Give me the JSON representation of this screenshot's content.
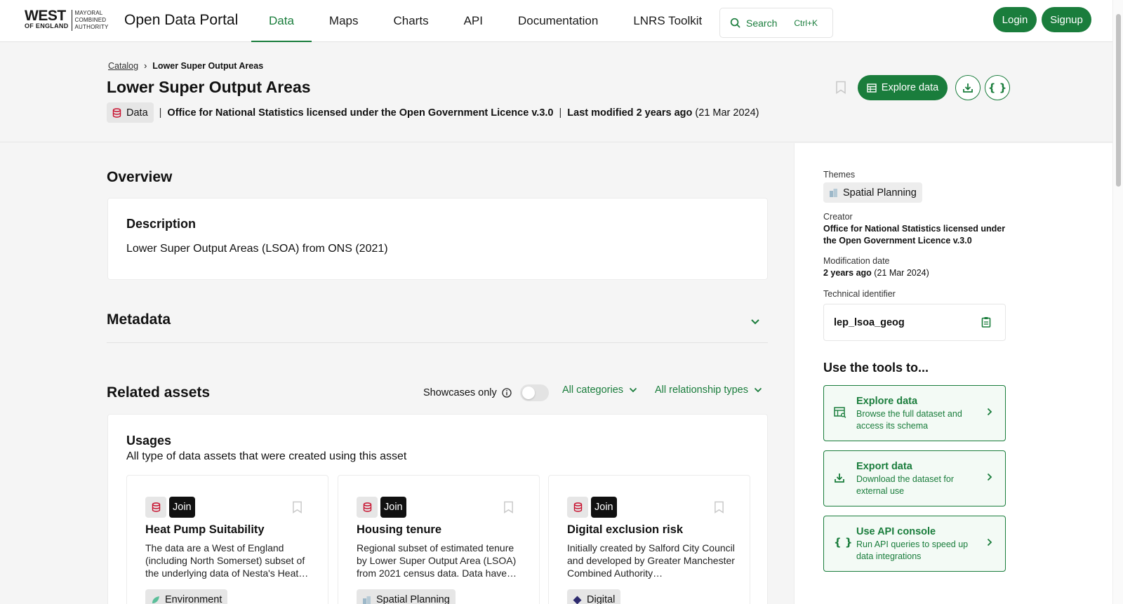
{
  "header": {
    "logo_main_1": "WEST",
    "logo_main_2": "OF ENGLAND",
    "logo_right_1": "MAYORAL",
    "logo_right_2": "COMBINED",
    "logo_right_3": "AUTHORITY",
    "portal_title": "Open Data Portal",
    "nav": [
      "Data",
      "Maps",
      "Charts",
      "API",
      "Documentation",
      "LNRS Toolkit"
    ],
    "active_nav": "Data",
    "search_label": "Search",
    "search_shortcut": "Ctrl+K",
    "login_label": "Login",
    "signup_label": "Signup"
  },
  "breadcrumb": {
    "parent": "Catalog",
    "separator": "›",
    "current": "Lower Super Output Areas"
  },
  "dataset": {
    "title": "Lower Super Output Areas",
    "type_label": "Data",
    "creator": "Office for National Statistics licensed under the Open Government Licence v.3.0",
    "modified_prefix": "Last modified",
    "modified_relative": "2 years ago",
    "modified_date": "(21 Mar 2024)",
    "explore_label": "Explore data"
  },
  "overview": {
    "heading": "Overview",
    "description_title": "Description",
    "description_text": "Lower Super Output Areas (LSOA) from ONS (2021)"
  },
  "metadata": {
    "heading": "Metadata"
  },
  "related": {
    "heading": "Related assets",
    "showcases_label": "Showcases only",
    "categories_label": "All categories",
    "relationship_label": "All relationship types",
    "usages_title": "Usages",
    "usages_subtitle": "All type of data assets that were created using this asset",
    "cards": [
      {
        "join_label": "Join",
        "title": "Heat Pump Suitability",
        "description": "The data are a West of England (including North Somerset) subset of the underlying data of Nesta's Heat…",
        "tag": "Environment",
        "tag_color": "#5bbf9a"
      },
      {
        "join_label": "Join",
        "title": "Housing tenure",
        "description": "Regional subset of estimated tenure by Lower Super Output Area (LSOA) from 2021 census data. Data have…",
        "tag": "Spatial Planning",
        "tag_color": "#9db8c9"
      },
      {
        "join_label": "Join",
        "title": "Digital exclusion risk",
        "description": "Initially created by Salford City Council and developed by Greater Manchester Combined Authority…",
        "tag": "Digital",
        "tag_color": "#2d2a6e"
      }
    ]
  },
  "sidebar": {
    "themes_label": "Themes",
    "theme": "Spatial Planning",
    "creator_label": "Creator",
    "creator_value": "Office for National Statistics licensed under the Open Government Licence v.3.0",
    "modification_label": "Modification date",
    "modification_relative": "2 years ago",
    "modification_date": "(21 Mar 2024)",
    "technical_label": "Technical identifier",
    "technical_value": "lep_lsoa_geog",
    "tools_heading": "Use the tools to...",
    "tools": [
      {
        "title": "Explore data",
        "description": "Browse the full dataset and access its schema"
      },
      {
        "title": "Export data",
        "description": "Download the dataset for external use"
      },
      {
        "title": "Use API console",
        "description": "Run API queries to speed up data integrations"
      }
    ]
  },
  "colors": {
    "accent": "#1a7d3c",
    "data_icon": "#c8102e"
  }
}
